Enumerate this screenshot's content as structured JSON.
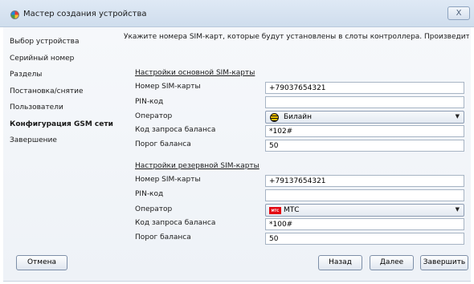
{
  "window": {
    "title": "Мастер создания устройства",
    "close_label": "X"
  },
  "nav": {
    "items": [
      {
        "label": "Выбор устройства"
      },
      {
        "label": "Серийный номер"
      },
      {
        "label": "Разделы"
      },
      {
        "label": "Постановка/снятие"
      },
      {
        "label": "Пользователи"
      },
      {
        "label": "Конфигурация GSM сети",
        "active": true
      },
      {
        "label": "Завершение"
      }
    ]
  },
  "hint": "Укажите номера SIM-карт, которые будут установлены в слоты контроллера. Произведите настройки",
  "primary": {
    "title": "Настройки основной SIM-карты",
    "sim_label": "Номер SIM-карты",
    "sim_value": "+79037654321",
    "pin_label": "PIN-код",
    "pin_value": "",
    "operator_label": "Оператор",
    "operator_value": "Билайн",
    "operator_icon": "beeline-logo",
    "balance_code_label": "Код запроса баланса",
    "balance_code_value": "*102#",
    "threshold_label": "Порог баланса",
    "threshold_value": "50"
  },
  "backup": {
    "title": "Настройки резервной SIM-карты",
    "sim_label": "Номер SIM-карты",
    "sim_value": "+79137654321",
    "pin_label": "PIN-код",
    "pin_value": "",
    "operator_label": "Оператор",
    "operator_value": "МТС",
    "operator_icon": "mts-logo",
    "operator_logo_text": "МТС",
    "balance_code_label": "Код запроса баланса",
    "balance_code_value": "*100#",
    "threshold_label": "Порог баланса",
    "threshold_value": "50"
  },
  "buttons": {
    "cancel": "Отмена",
    "back": "Назад",
    "next": "Далее",
    "finish": "Завершить"
  }
}
